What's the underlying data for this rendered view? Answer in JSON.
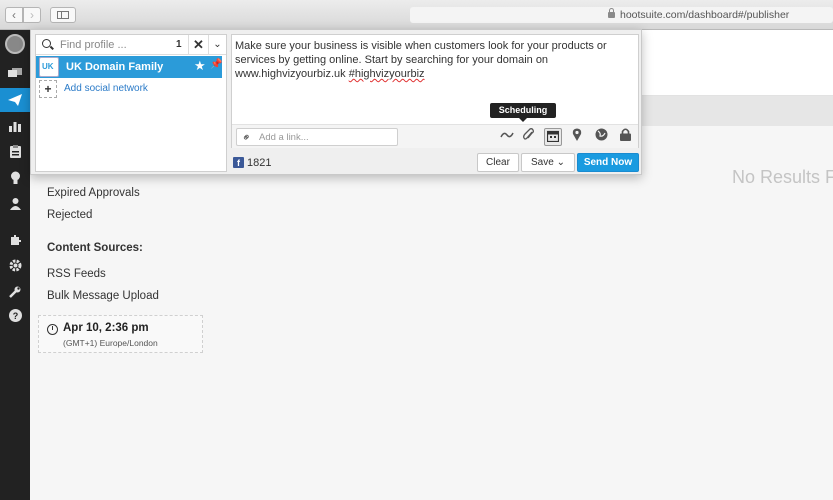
{
  "browser": {
    "url": "hootsuite.com/dashboard#/publisher",
    "back_glyph": "‹",
    "forward_glyph": "›"
  },
  "icons": {
    "appbar": [
      "streams-icon",
      "publisher-icon",
      "analytics-icon",
      "assignments-icon",
      "campaigns-icon",
      "contacts-icon",
      "apps-icon",
      "settings-icon",
      "tools-icon",
      "help-icon"
    ],
    "toolbar": [
      "wave-icon",
      "attach-icon",
      "scheduling-icon",
      "location-icon",
      "globe-icon",
      "lock-icon"
    ]
  },
  "colors": {
    "accent": "#1a9be0",
    "sidebar_active": "#1a8fd2",
    "appbar_bg": "#222222",
    "facebook": "#3b5998"
  },
  "background_page": {
    "nav_items": {
      "expired_approvals": "Expired Approvals",
      "rejected": "Rejected",
      "content_sources": "Content Sources:",
      "rss_feeds": "RSS Feeds",
      "bulk_upload": "Bulk Message Upload"
    },
    "schedule": {
      "time": "Apr 10, 2:36 pm",
      "timezone": "(GMT+1) Europe/London"
    },
    "no_results": "No Results F"
  },
  "composer": {
    "profile_search": {
      "placeholder": "Find profile ...",
      "count": "1",
      "close_glyph": "✕",
      "expand_glyph": "⌄"
    },
    "profiles": [
      {
        "name": "UK Domain Family",
        "selected": true
      }
    ],
    "add_network_label": "Add social network",
    "message": {
      "text": "Make sure your business is visible when customers look for your products or services by getting online. Start by searching for your domain on www.highvizyourbiz.uk ",
      "hashtag": "#highvizyourbiz"
    },
    "link_placeholder": "Add a link...",
    "tooltip": "Scheduling",
    "network_glyph": "f",
    "char_count": "1821",
    "buttons": {
      "clear": "Clear",
      "save": "Save",
      "send": "Send Now"
    }
  }
}
